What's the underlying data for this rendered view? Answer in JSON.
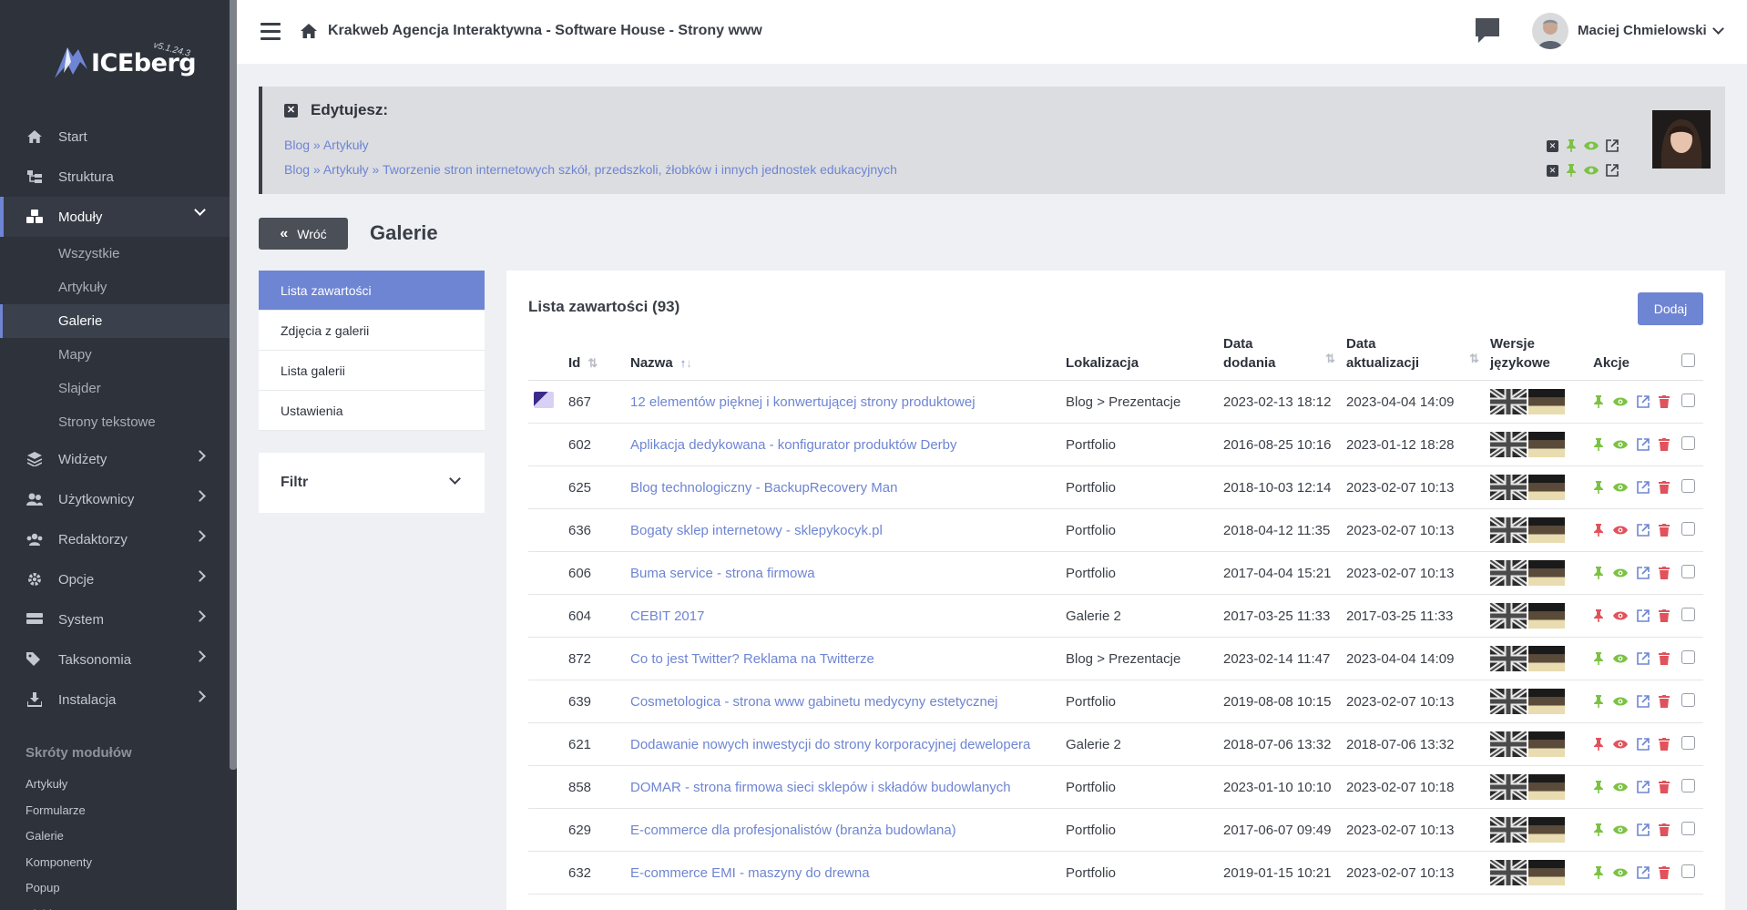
{
  "app": {
    "brand": "ICEberg",
    "version": "v5.1.24.3",
    "site_title": "Krakweb Agencja Interaktywna - Software House - Strony www",
    "user_name": "Maciej Chmielowski"
  },
  "sidebar": {
    "menu": [
      {
        "label": "Start",
        "icon": "home-icon"
      },
      {
        "label": "Struktura",
        "icon": "structure-icon"
      },
      {
        "label": "Moduły",
        "icon": "modules-icon",
        "active": true
      },
      {
        "label": "Widżety",
        "icon": "widgets-icon"
      },
      {
        "label": "Użytkownicy",
        "icon": "users-icon"
      },
      {
        "label": "Redaktorzy",
        "icon": "editors-icon"
      },
      {
        "label": "Opcje",
        "icon": "gear-icon"
      },
      {
        "label": "System",
        "icon": "system-icon"
      },
      {
        "label": "Taksonomia",
        "icon": "tags-icon"
      },
      {
        "label": "Instalacja",
        "icon": "download-icon"
      }
    ],
    "submenu": [
      "Wszystkie",
      "Artykuły",
      "Galerie",
      "Mapy",
      "Slajder",
      "Strony tekstowe"
    ],
    "shortcuts_title": "Skróty modułów",
    "shortcuts": [
      "Artykuły",
      "Formularze",
      "Galerie",
      "Komponenty",
      "Popup",
      "Slajder"
    ]
  },
  "editing": {
    "title": "Edytujesz:",
    "line1": {
      "a": "Blog",
      "sep": "»",
      "b": "Artykuły"
    },
    "line2": {
      "a": "Blog",
      "sep1": "»",
      "b": "Artykuły",
      "sep2": "»",
      "c": "Tworzenie stron internetowych szkół, przedszkoli, żłobków i innych jednostek edukacyjnych"
    }
  },
  "page": {
    "back_label": "Wróć",
    "heading": "Galerie"
  },
  "leftnav": [
    "Lista zawartości",
    "Zdjęcia z galerii",
    "Lista galerii",
    "Ustawienia"
  ],
  "filter_label": "Filtr",
  "content": {
    "title": "Lista zawartości (93)",
    "add_label": "Dodaj",
    "columns": {
      "id": "Id",
      "name": "Nazwa",
      "location": "Lokalizacja",
      "date_added_1": "Data",
      "date_added_2": "dodania",
      "date_updated_1": "Data",
      "date_updated_2": "aktualizacji",
      "versions_1": "Wersje",
      "versions_2": "językowe",
      "actions": "Akcje"
    },
    "rows": [
      {
        "id": "867",
        "name": "12 elementów pięknej i konwertującej strony produktowej",
        "location": "Blog > Prezentacje",
        "added": "2023-02-13 18:12",
        "updated": "2023-04-04 14:09",
        "thumb": true,
        "pin": "green"
      },
      {
        "id": "602",
        "name": "Aplikacja dedykowana - konfigurator produktów Derby",
        "location": "Portfolio",
        "added": "2016-08-25 10:16",
        "updated": "2023-01-12 18:28",
        "pin": "green"
      },
      {
        "id": "625",
        "name": "Blog technologiczny - BackupRecovery Man",
        "location": "Portfolio",
        "added": "2018-10-03 12:14",
        "updated": "2023-02-07 10:13",
        "pin": "green"
      },
      {
        "id": "636",
        "name": "Bogaty sklep internetowy - sklepykocyk.pl",
        "location": "Portfolio",
        "added": "2018-04-12 11:35",
        "updated": "2023-02-07 10:13",
        "pin": "red"
      },
      {
        "id": "606",
        "name": "Buma service - strona firmowa",
        "location": "Portfolio",
        "added": "2017-04-04 15:21",
        "updated": "2023-02-07 10:13",
        "pin": "green"
      },
      {
        "id": "604",
        "name": "CEBIT 2017",
        "location": "Galerie 2",
        "added": "2017-03-25 11:33",
        "updated": "2017-03-25 11:33",
        "pin": "red"
      },
      {
        "id": "872",
        "name": "Co to jest Twitter? Reklama na Twitterze",
        "location": "Blog > Prezentacje",
        "added": "2023-02-14 11:47",
        "updated": "2023-04-04 14:09",
        "pin": "green"
      },
      {
        "id": "639",
        "name": "Cosmetologica - strona www gabinetu medycyny estetycznej",
        "location": "Portfolio",
        "added": "2019-08-08 10:15",
        "updated": "2023-02-07 10:13",
        "pin": "green"
      },
      {
        "id": "621",
        "name": "Dodawanie nowych inwestycji do strony korporacyjnej dewelopera",
        "location": "Galerie 2",
        "added": "2018-07-06 13:32",
        "updated": "2018-07-06 13:32",
        "pin": "red"
      },
      {
        "id": "858",
        "name": "DOMAR - strona firmowa sieci sklepów i składów budowlanych",
        "location": "Portfolio",
        "added": "2023-01-10 10:10",
        "updated": "2023-02-07 10:18",
        "pin": "green"
      },
      {
        "id": "629",
        "name": "E-commerce dla profesjonalistów (branża budowlana)",
        "location": "Portfolio",
        "added": "2017-06-07 09:49",
        "updated": "2023-02-07 10:13",
        "pin": "green"
      },
      {
        "id": "632",
        "name": "E-commerce EMI - maszyny do drewna",
        "location": "Portfolio",
        "added": "2019-01-15 10:21",
        "updated": "2023-02-07 10:13",
        "pin": "green"
      }
    ]
  },
  "colors": {
    "sidebar_bg": "#2d323b",
    "accent": "#6e85d3",
    "green": "#7cc243",
    "red": "#e0525c"
  }
}
